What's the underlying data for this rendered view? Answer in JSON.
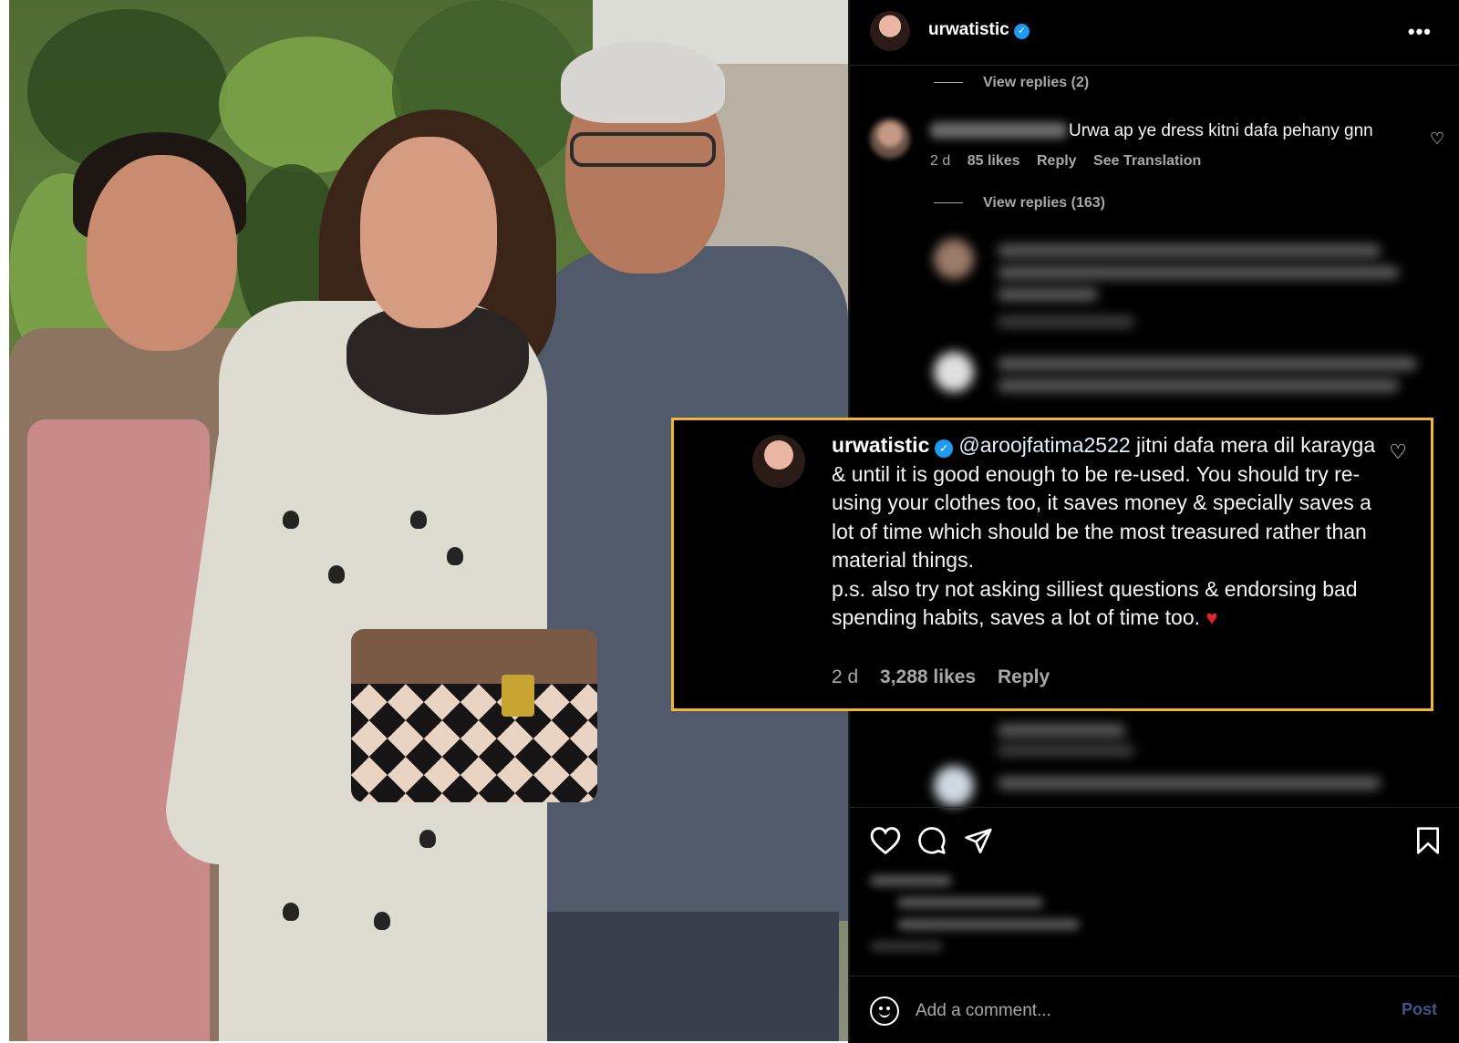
{
  "post": {
    "username": "urwatistic",
    "verified_mark": "✓",
    "more_icon": "•••"
  },
  "thread": {
    "view_replies_1": "View replies (2)",
    "comment1": {
      "text": "Urwa ap ye dress kitni dafa pehany gnn",
      "time": "2 d",
      "likes": "85 likes",
      "reply": "Reply",
      "see_translation": "See Translation"
    },
    "view_replies_2": "View replies (163)"
  },
  "highlighted_reply": {
    "username": "urwatistic",
    "mention": "@aroojfatima2522",
    "text": " jitni dafa mera dil karayga & until it is good enough to be re-used. You should try re-using your clothes too, it saves money & specially saves a lot of time which should be the most treasured rather than material things.",
    "ps": "p.s. also try not asking silliest questions & endorsing bad spending habits, saves a lot of time too.",
    "emoji": "♥",
    "time": "2 d",
    "likes": "3,288 likes",
    "reply": "Reply",
    "border_color": "#f2b731"
  },
  "actions": {
    "like_icon": "heart-icon",
    "comment_icon": "comment-icon",
    "share_icon": "send-icon",
    "save_icon": "bookmark-icon"
  },
  "comment_box": {
    "placeholder": "Add a comment...",
    "post_label": "Post"
  },
  "colors": {
    "panel_bg": "#000000",
    "secondary_text": "#a8a8a8",
    "verified": "#1d9bf0",
    "post_button": "#3a5a8a"
  }
}
